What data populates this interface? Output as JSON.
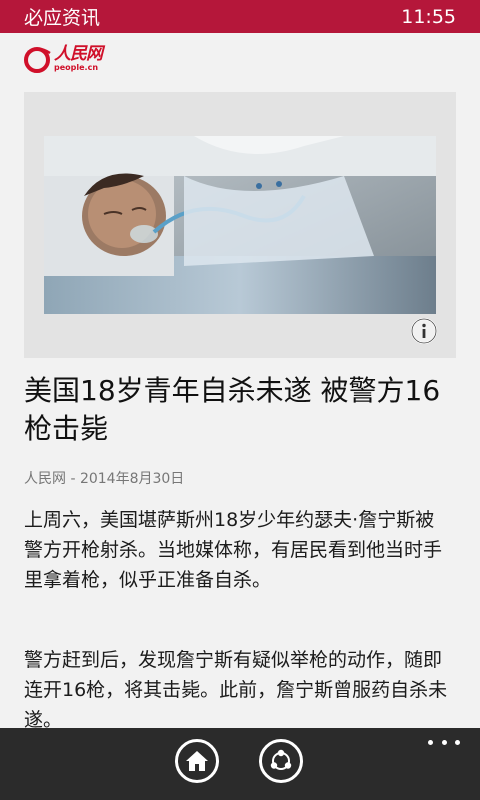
{
  "status_bar": {
    "app_title": "必应资讯",
    "time": "11:55"
  },
  "logo": {
    "name_cn": "人民网",
    "name_en": "people.cn"
  },
  "article": {
    "image_alt_icon": "info-icon",
    "headline": "美国18岁青年自杀未遂 被警方16枪击毙",
    "source": "人民网",
    "separator": " - ",
    "date": "2014年8月30日",
    "paragraphs": [
      "上周六，美国堪萨斯州18岁少年约瑟夫·詹宁斯被警方开枪射杀。当地媒体称，有居民看到他当时手里拿着枪，似乎正准备自杀。",
      "警方赶到后，发现詹宁斯有疑似举枪的动作，随即连开16枪，将其击毙。此前，詹宁斯曾服药自杀未遂。"
    ]
  },
  "app_bar": {
    "buttons": [
      "home-icon",
      "share-icon"
    ],
    "more_icon": "more-dots-icon"
  },
  "colors": {
    "status_bar": "#b5173a",
    "app_bar": "#2b2b2b",
    "brand_red": "#d0102a"
  }
}
